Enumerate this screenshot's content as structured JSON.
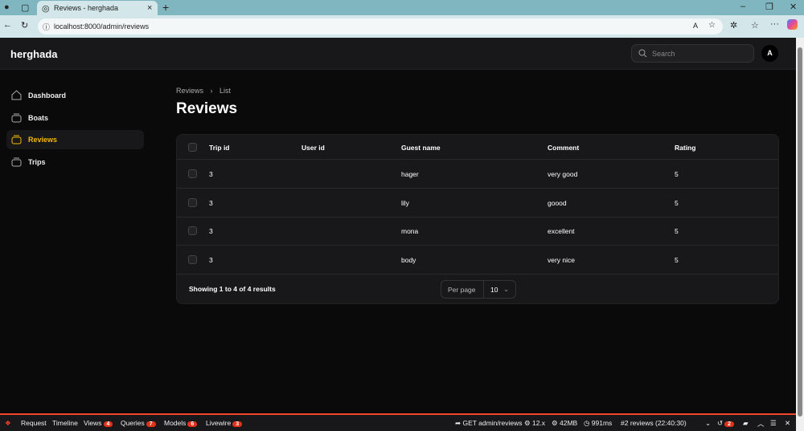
{
  "browser": {
    "tab_title": "Reviews - herghada",
    "url": "localhost:8000/admin/reviews"
  },
  "header": {
    "brand": "herghada",
    "search_placeholder": "Search",
    "avatar_initial": "A"
  },
  "sidebar": {
    "items": [
      {
        "label": "Dashboard"
      },
      {
        "label": "Boats"
      },
      {
        "label": "Reviews",
        "active": true
      },
      {
        "label": "Trips"
      }
    ]
  },
  "breadcrumb": [
    "Reviews",
    "List"
  ],
  "page_title": "Reviews",
  "table": {
    "columns": [
      "Trip id",
      "User id",
      "Guest name",
      "Comment",
      "Rating"
    ],
    "rows": [
      [
        "3",
        "",
        "hager",
        "very good",
        "5"
      ],
      [
        "3",
        "",
        "lily",
        "goood",
        "5"
      ],
      [
        "3",
        "",
        "mona",
        "excellent",
        "5"
      ],
      [
        "3",
        "",
        "body",
        "very nice",
        "5"
      ]
    ],
    "summary": "Showing 1 to 4 of 4 results",
    "per_page_label": "Per page",
    "per_page_value": "10"
  },
  "debugbar": {
    "tabs": [
      {
        "label": "Request"
      },
      {
        "label": "Timeline"
      },
      {
        "label": "Views",
        "count": "4"
      },
      {
        "label": "Queries",
        "count": "7"
      },
      {
        "label": "Models",
        "count": "6"
      },
      {
        "label": "Livewire",
        "count": "3"
      }
    ],
    "route": "GET admin/reviews",
    "version": "12.x",
    "memory": "42MB",
    "time": "991ms",
    "request": "#2 reviews (22:40:30)",
    "history_count": "2"
  },
  "colors": {
    "accent": "#f5b800",
    "debug_red": "#f4442e"
  }
}
